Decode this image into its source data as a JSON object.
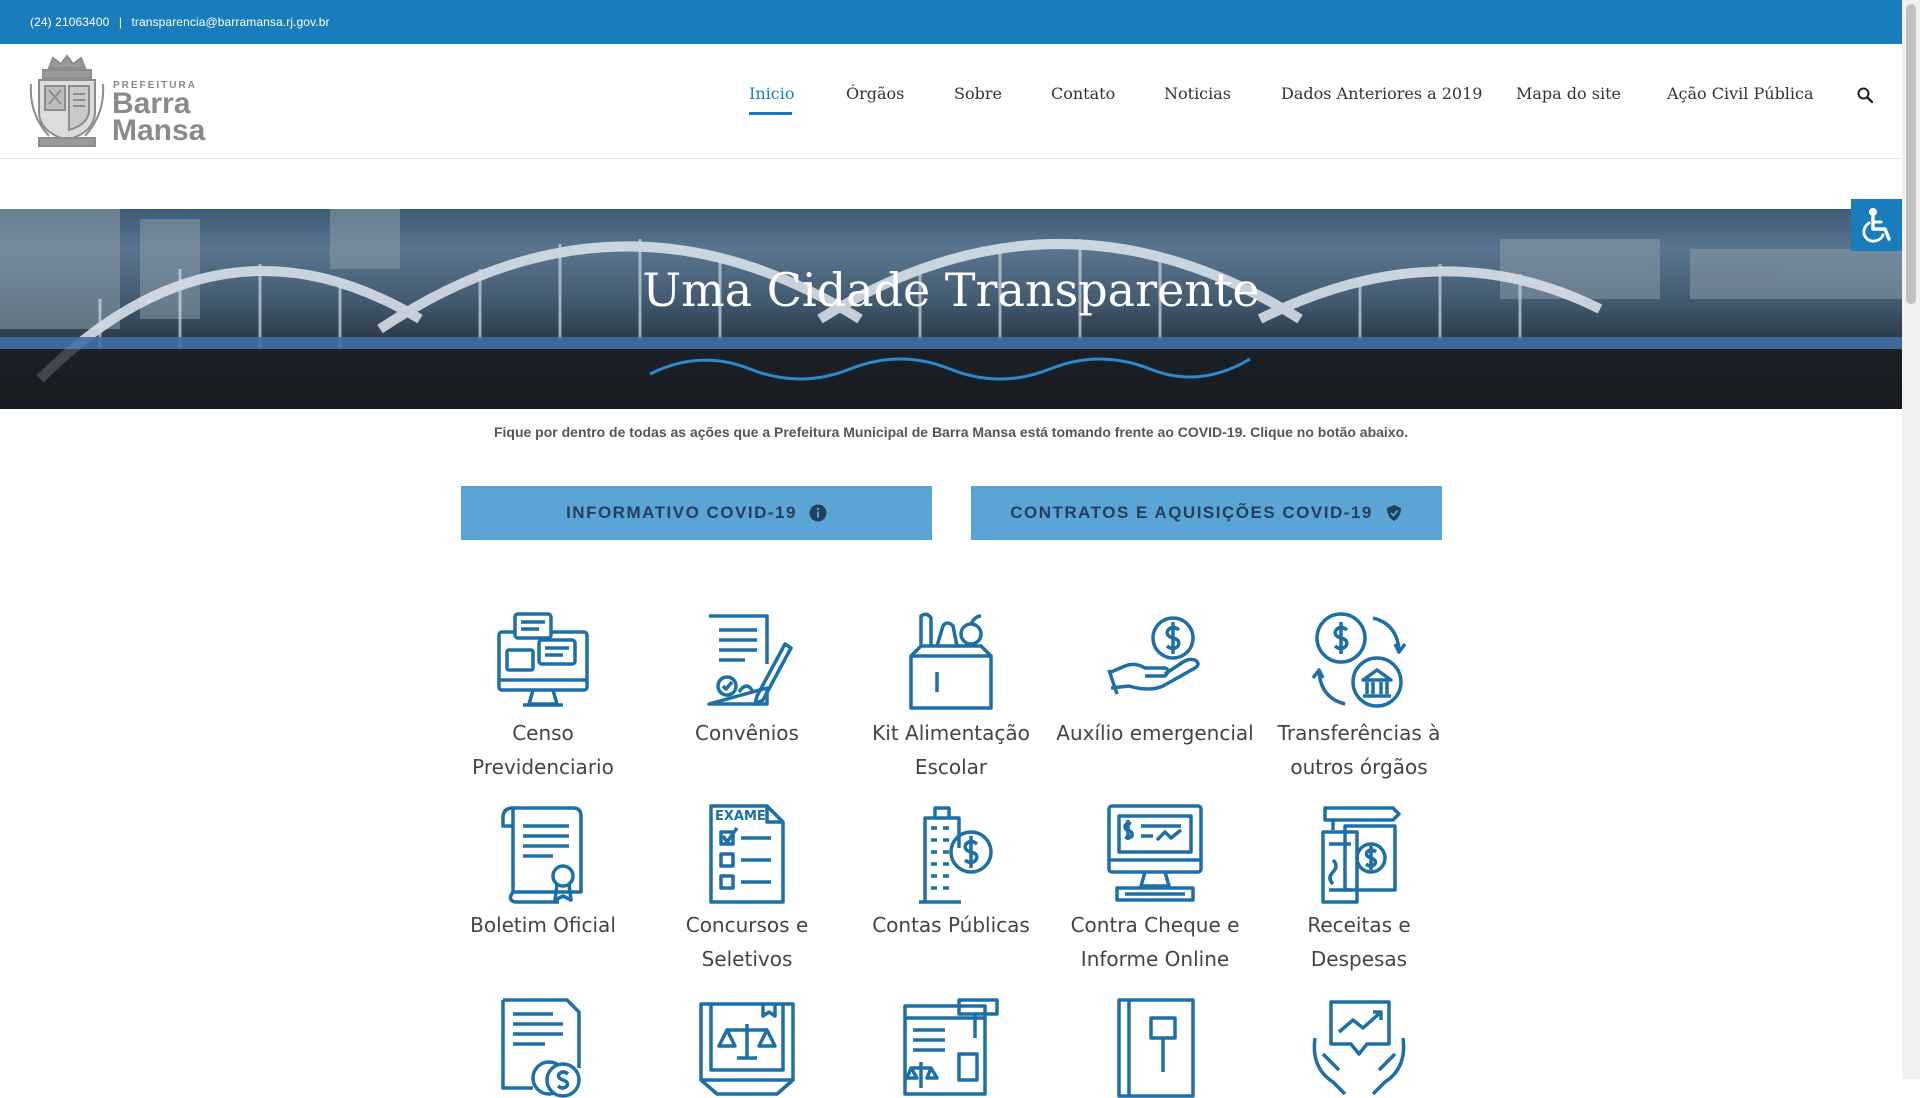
{
  "topbar": {
    "phone": "(24) 21063400",
    "separator": "|",
    "email": "transparencia@barramansa.rj.gov.br"
  },
  "logo": {
    "small": "PREFEITURA",
    "line1": "Barra",
    "line2": "Mansa"
  },
  "nav": {
    "items": [
      {
        "label": "Inicio",
        "active": true
      },
      {
        "label": "Órgãos"
      },
      {
        "label": "Sobre"
      },
      {
        "label": "Contato"
      },
      {
        "label": "Noticias"
      },
      {
        "label": "Dados Anteriores a 2019"
      },
      {
        "label": "Mapa do site"
      },
      {
        "label": "Ação Civil Pública"
      }
    ],
    "search_icon": "search-icon"
  },
  "hero": {
    "title": "Uma Cidade Transparente"
  },
  "covid": {
    "text": "Fique por dentro de todas as ações que a Prefeitura Municipal de Barra Mansa está tomando frente ao COVID-19. Clique no botão abaixo.",
    "buttons": [
      {
        "label": "INFORMATIVO COVID-19",
        "icon": "info-icon"
      },
      {
        "label": "CONTRATOS E AQUISIÇÕES COVID-19",
        "icon": "shield-icon"
      }
    ]
  },
  "cards": [
    {
      "label": "Censo Previdenciario",
      "icon": "monitor-chat-icon"
    },
    {
      "label": "Convênios",
      "icon": "contract-signing-icon"
    },
    {
      "label": "Kit Alimentação Escolar",
      "icon": "grocery-bag-icon"
    },
    {
      "label": "Auxílio emergencial",
      "icon": "hand-coin-icon"
    },
    {
      "label": "Transferências à outros órgãos",
      "icon": "money-bank-transfer-icon"
    },
    {
      "label": "Boletim Oficial",
      "icon": "scroll-certificate-icon"
    },
    {
      "label": "Concursos e Seletivos",
      "icon": "exam-checklist-icon"
    },
    {
      "label": "Contas Públicas",
      "icon": "building-dollar-icon"
    },
    {
      "label": "Contra Cheque e Informe Online",
      "icon": "monitor-check-icon"
    },
    {
      "label": "Receitas e Despesas",
      "icon": "money-documents-icon"
    },
    {
      "label": "",
      "icon": "document-coins-icon"
    },
    {
      "label": "",
      "icon": "book-scales-icon"
    },
    {
      "label": "",
      "icon": "web-gavel-icon"
    },
    {
      "label": "",
      "icon": "book-gavel-icon"
    },
    {
      "label": "",
      "icon": "hands-chart-icon"
    }
  ],
  "colors": {
    "primary": "#1a7dbb",
    "button": "#5ba4d6",
    "button_text": "#23405b"
  },
  "accessibility": {
    "icon": "accessibility-icon"
  }
}
